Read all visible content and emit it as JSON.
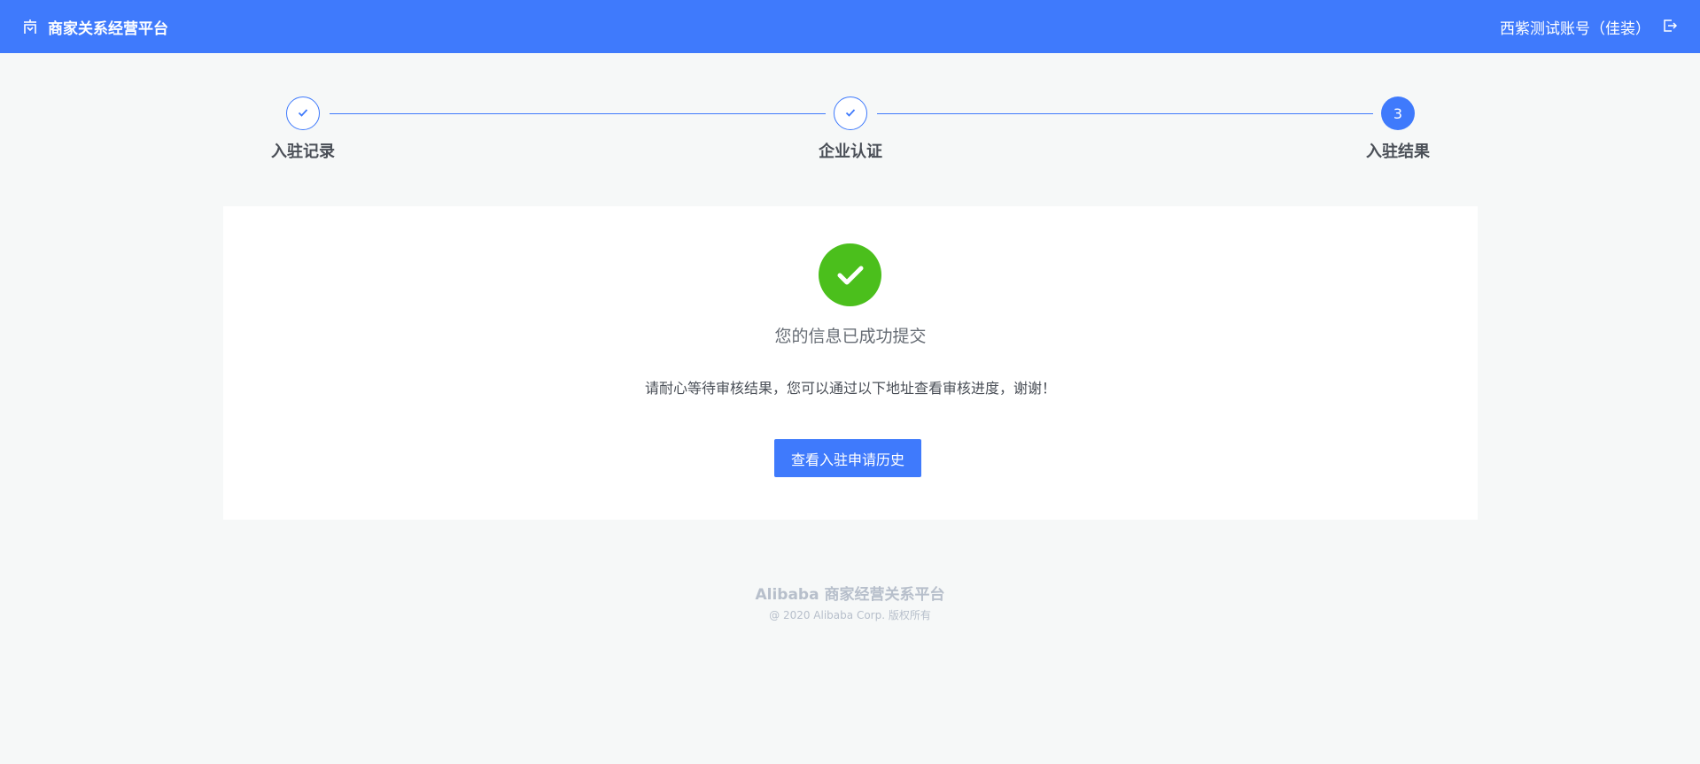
{
  "header": {
    "title": "商家关系经营平台",
    "logo_icon": "shop-logo-icon",
    "user_name": "西紫测试账号（佳装）",
    "logout_icon": "logout-icon"
  },
  "steps": [
    {
      "label": "入驻记录",
      "status": "done"
    },
    {
      "label": "企业认证",
      "status": "done"
    },
    {
      "label": "入驻结果",
      "status": "current",
      "number": "3"
    }
  ],
  "result": {
    "title": "您的信息已成功提交",
    "description": "请耐心等待审核结果，您可以通过以下地址查看审核进度，谢谢！",
    "button_label": "查看入驻申请历史"
  },
  "footer": {
    "brand": "Alibaba 商家经营关系平台",
    "copyright": "@ 2020 Alibaba Corp. 版权所有"
  },
  "colors": {
    "primary": "#3f7afc",
    "success": "#4bbf1c",
    "background": "#f6f8f8",
    "footer_text": "#b7bfcb"
  }
}
